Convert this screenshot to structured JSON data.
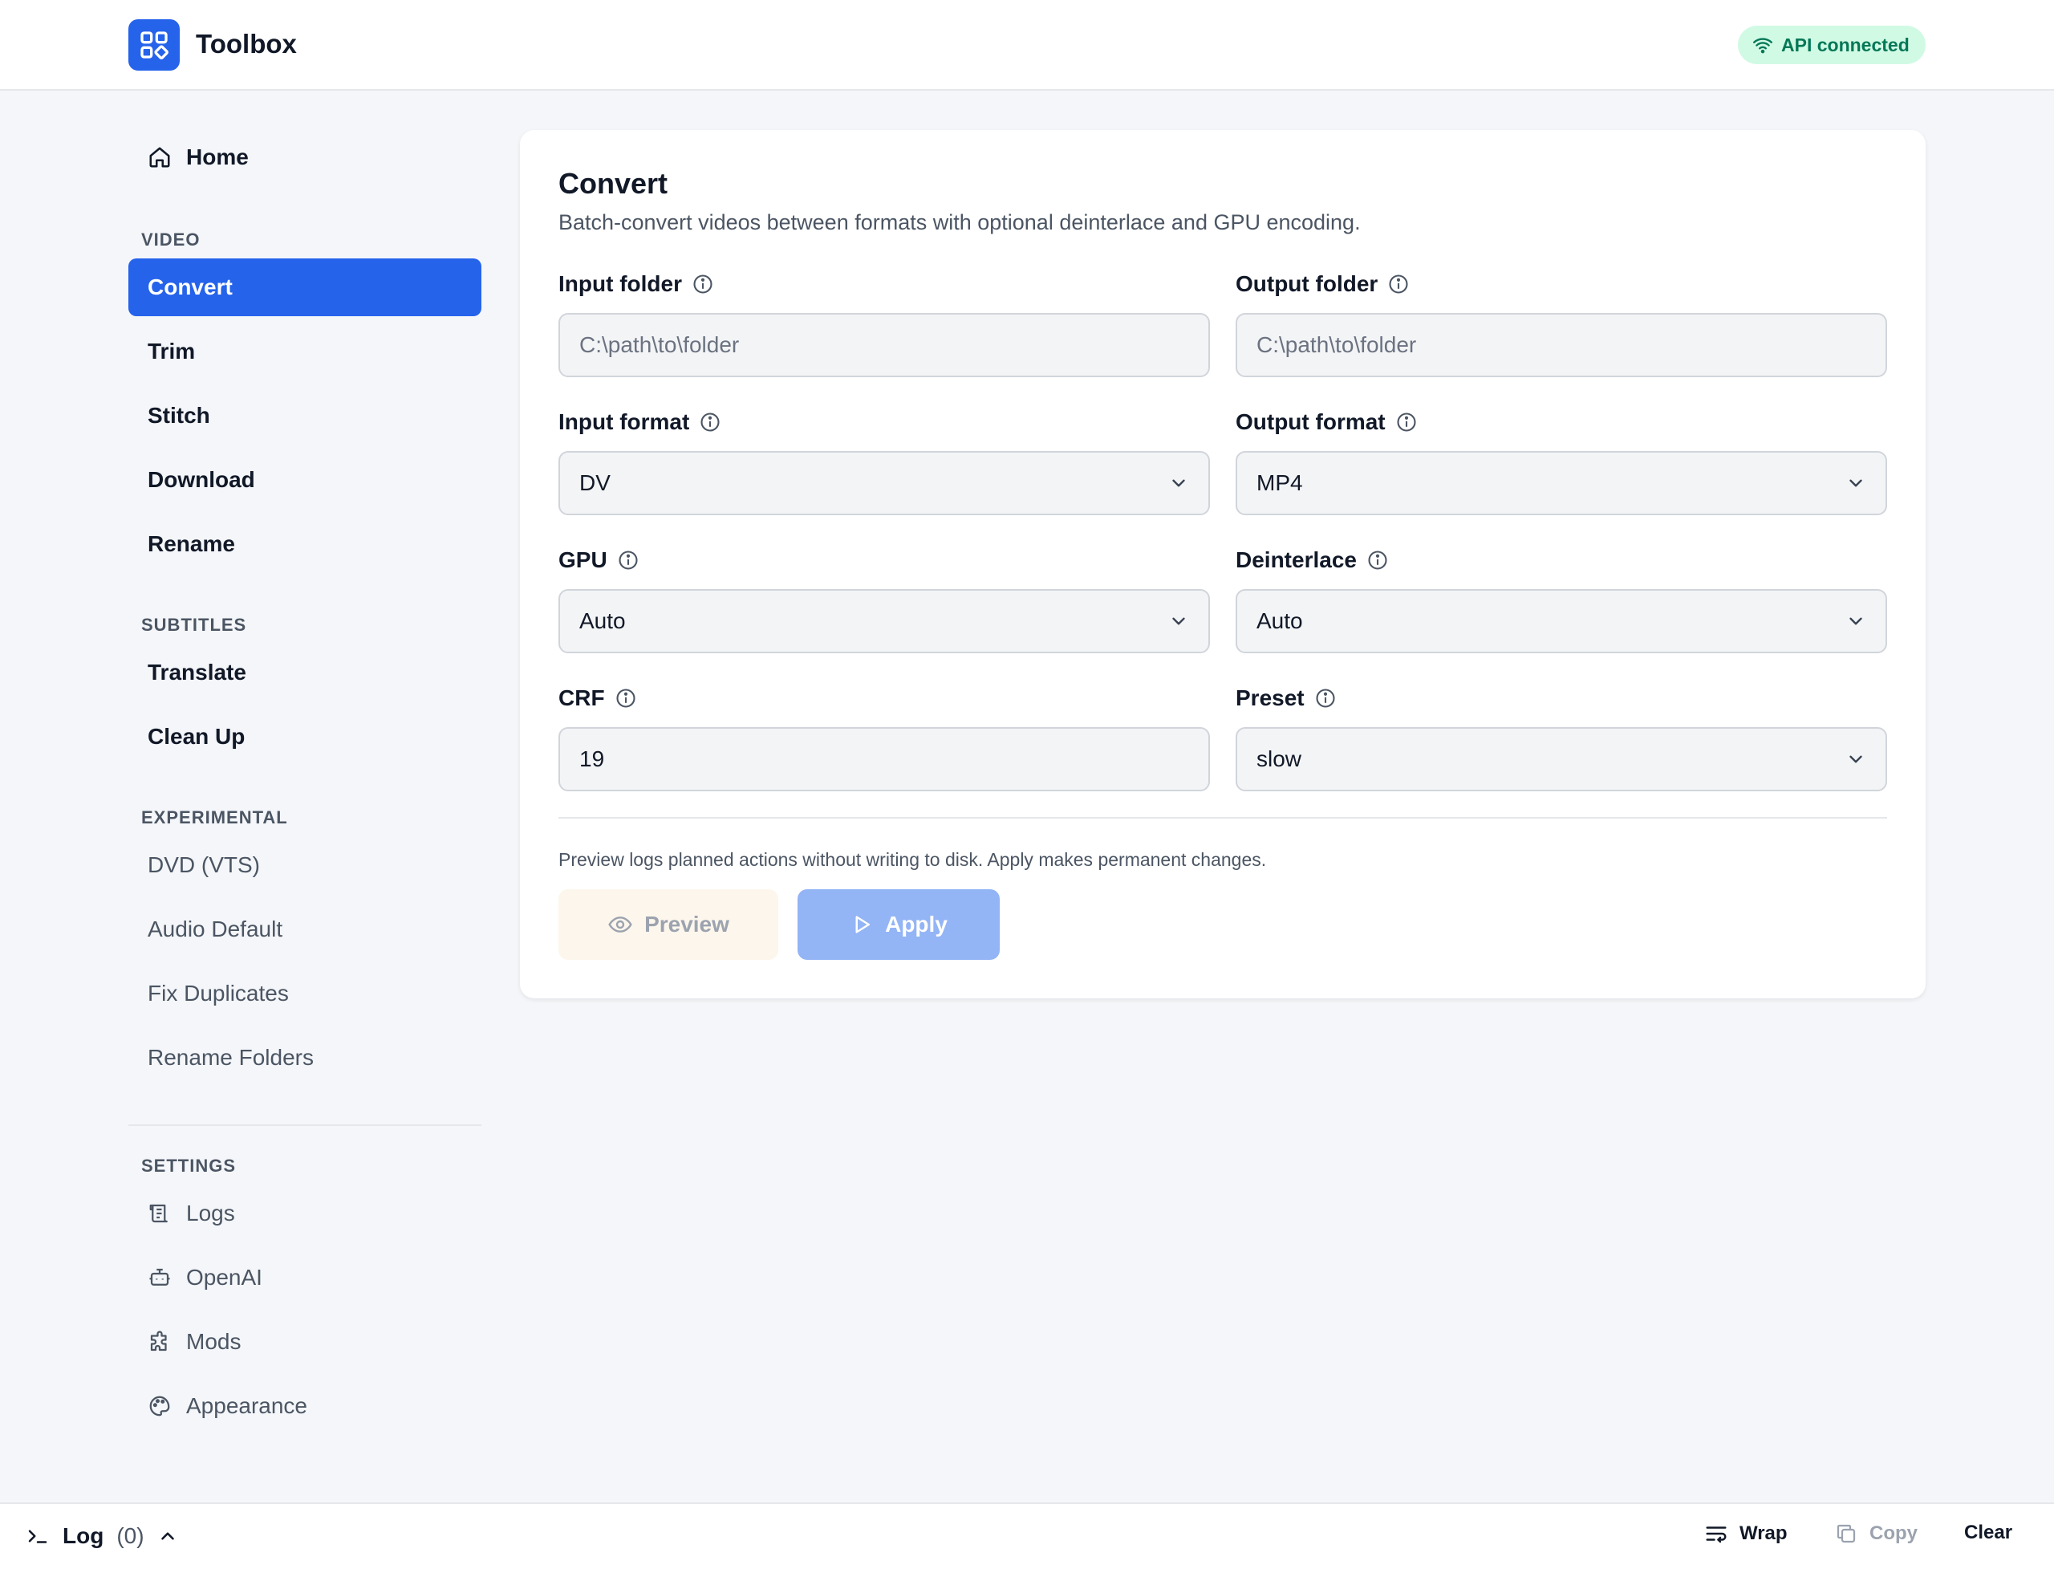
{
  "app": {
    "title": "Toolbox",
    "accent": "#2563eb"
  },
  "header": {
    "status_label": "API connected",
    "status_color": "#047857"
  },
  "sidebar": {
    "home": "Home",
    "sections": {
      "video": "VIDEO",
      "subtitles": "SUBTITLES",
      "experimental": "EXPERIMENTAL",
      "settings": "SETTINGS"
    },
    "video_items": [
      "Convert",
      "Trim",
      "Stitch",
      "Download",
      "Rename"
    ],
    "subtitle_items": [
      "Translate",
      "Clean Up"
    ],
    "experimental_items": [
      "DVD (VTS)",
      "Audio Default",
      "Fix Duplicates",
      "Rename Folders"
    ],
    "settings_items": [
      "Logs",
      "OpenAI",
      "Mods",
      "Appearance"
    ],
    "active_item": "Convert"
  },
  "main": {
    "title": "Convert",
    "description": "Batch-convert videos between formats with optional deinterlace and GPU encoding.",
    "fields": {
      "input_folder": {
        "label": "Input folder",
        "placeholder": "C:\\path\\to\\folder"
      },
      "output_folder": {
        "label": "Output folder",
        "placeholder": "C:\\path\\to\\folder"
      },
      "input_format": {
        "label": "Input format",
        "value": "DV"
      },
      "output_format": {
        "label": "Output format",
        "value": "MP4"
      },
      "gpu": {
        "label": "GPU",
        "value": "Auto"
      },
      "deinterlace": {
        "label": "Deinterlace",
        "value": "Auto"
      },
      "crf": {
        "label": "CRF",
        "value": "19"
      },
      "preset": {
        "label": "Preset",
        "value": "slow"
      }
    },
    "hint": "Preview logs planned actions without writing to disk. Apply makes permanent changes.",
    "preview_label": "Preview",
    "apply_label": "Apply"
  },
  "footer": {
    "log_label": "Log",
    "log_count": "(0)",
    "wrap_label": "Wrap",
    "copy_label": "Copy",
    "clear_label": "Clear"
  }
}
